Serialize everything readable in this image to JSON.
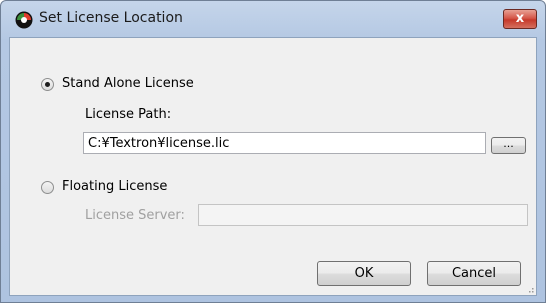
{
  "dialog": {
    "title": "Set License Location",
    "close_label": "x"
  },
  "standalone": {
    "label": "Stand Alone License",
    "selected": true,
    "path_label": "License Path:",
    "path_value": "C:¥Textron¥license.lic",
    "browse_label": "..."
  },
  "floating": {
    "label": "Floating License",
    "selected": false,
    "server_label": "License Server:",
    "server_value": ""
  },
  "buttons": {
    "ok": "OK",
    "cancel": "Cancel"
  },
  "icons": {
    "app": "app-logo-icon",
    "close": "close-icon"
  }
}
